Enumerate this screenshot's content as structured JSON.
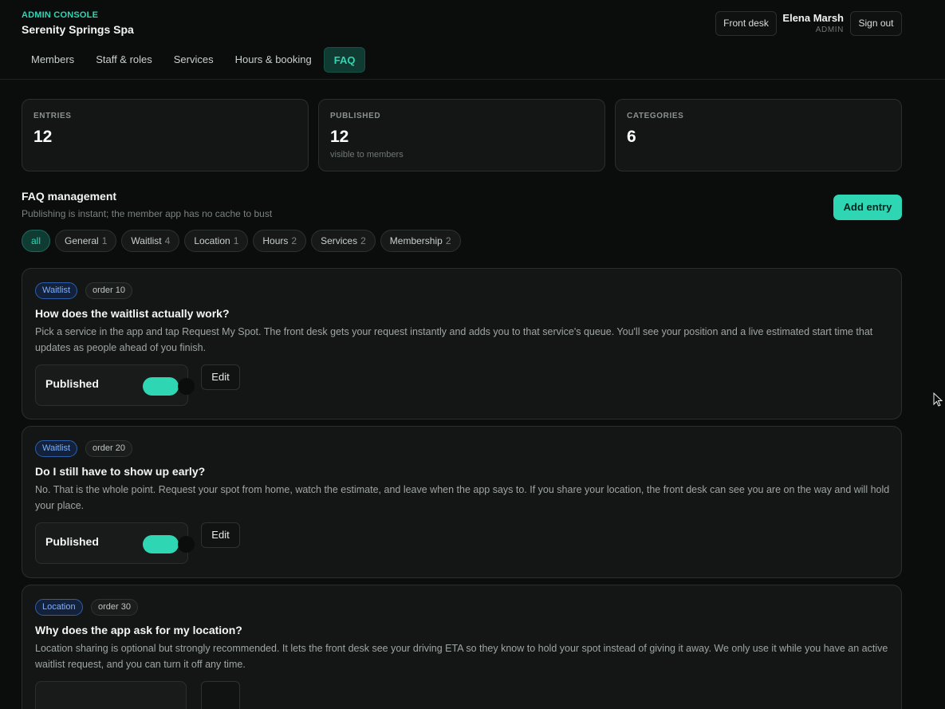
{
  "header": {
    "eyebrow": "ADMIN CONSOLE",
    "org_name": "Serenity Springs Spa",
    "front_desk_label": "Front desk",
    "user_name": "Elena Marsh",
    "user_role": "ADMIN",
    "sign_out_label": "Sign out"
  },
  "nav": {
    "tabs": [
      {
        "label": "Members",
        "active": false
      },
      {
        "label": "Staff & roles",
        "active": false
      },
      {
        "label": "Services",
        "active": false
      },
      {
        "label": "Hours & booking",
        "active": false
      },
      {
        "label": "FAQ",
        "active": true
      }
    ]
  },
  "stats": [
    {
      "label": "ENTRIES",
      "value": "12",
      "sub": ""
    },
    {
      "label": "PUBLISHED",
      "value": "12",
      "sub": "visible to members"
    },
    {
      "label": "CATEGORIES",
      "value": "6",
      "sub": ""
    }
  ],
  "section": {
    "title": "FAQ management",
    "subtitle": "Publishing is instant; the member app has no cache to bust",
    "add_label": "Add entry"
  },
  "filters": [
    {
      "label": "all",
      "count": "",
      "active": true
    },
    {
      "label": "General",
      "count": "1",
      "active": false
    },
    {
      "label": "Waitlist",
      "count": "4",
      "active": false
    },
    {
      "label": "Location",
      "count": "1",
      "active": false
    },
    {
      "label": "Hours",
      "count": "2",
      "active": false
    },
    {
      "label": "Services",
      "count": "2",
      "active": false
    },
    {
      "label": "Membership",
      "count": "2",
      "active": false
    }
  ],
  "faqs": [
    {
      "category": "Waitlist",
      "order": "order 10",
      "question": "How does the waitlist actually work?",
      "answer": "Pick a service in the app and tap Request My Spot. The front desk gets your request instantly and adds you to that service's queue. You'll see your position and a live estimated start time that updates as people ahead of you finish.",
      "published_label": "Published",
      "published": true,
      "edit_label": "Edit"
    },
    {
      "category": "Waitlist",
      "order": "order 20",
      "question": "Do I still have to show up early?",
      "answer": "No. That is the whole point. Request your spot from home, watch the estimate, and leave when the app says to. If you share your location, the front desk can see you are on the way and will hold your place.",
      "published_label": "Published",
      "published": true,
      "edit_label": "Edit"
    },
    {
      "category": "Location",
      "order": "order 30",
      "question": "Why does the app ask for my location?",
      "answer": "Location sharing is optional but strongly recommended. It lets the front desk see your driving ETA so they know to hold your spot instead of giving it away. We only use it while you have an active waitlist request, and you can turn it off any time.",
      "published_label": "",
      "published": true,
      "edit_label": ""
    }
  ],
  "colors": {
    "accent": "#2fd6b3",
    "background": "#0b0c0c",
    "card": "#141616",
    "tag_blue": "#7fb0ff"
  }
}
